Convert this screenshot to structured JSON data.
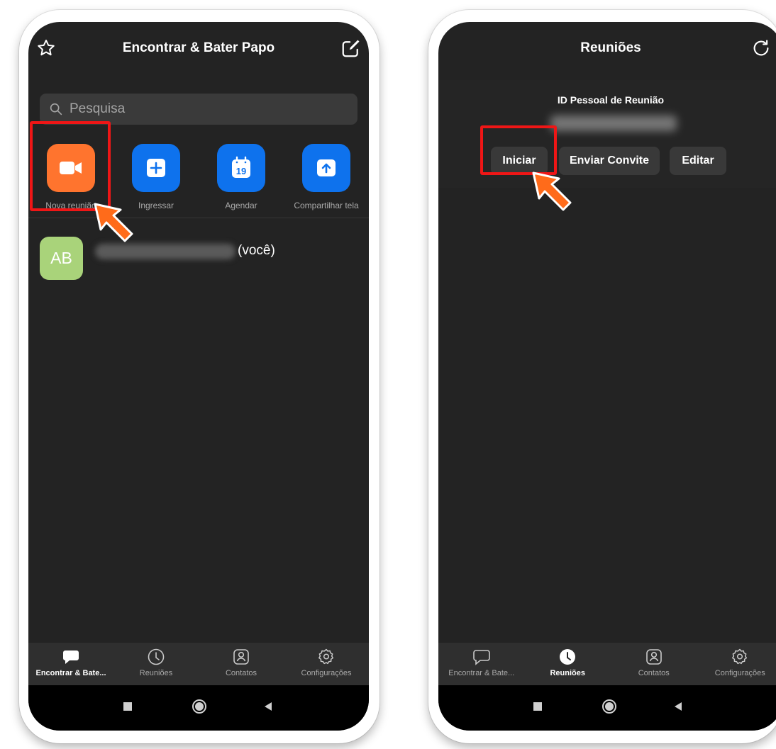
{
  "screen1": {
    "title": "Encontrar & Bater Papo",
    "search": {
      "placeholder": "Pesquisa"
    },
    "actions": [
      {
        "label": "Nova reunião",
        "icon": "video-camera-icon"
      },
      {
        "label": "Ingressar",
        "icon": "plus-icon"
      },
      {
        "label": "Agendar",
        "icon": "calendar-icon",
        "calendar_day": "19"
      },
      {
        "label": "Compartilhar tela",
        "icon": "share-screen-icon"
      }
    ],
    "contact": {
      "initials": "AB",
      "suffix": "(você)"
    },
    "tabs": [
      {
        "label": "Encontrar & Bate...",
        "icon": "chat-icon",
        "active": true
      },
      {
        "label": "Reuniões",
        "icon": "clock-icon",
        "active": false
      },
      {
        "label": "Contatos",
        "icon": "contacts-icon",
        "active": false
      },
      {
        "label": "Configurações",
        "icon": "gear-icon",
        "active": false
      }
    ]
  },
  "screen2": {
    "title": "Reuniões",
    "personal_meeting": {
      "label": "ID Pessoal de Reunião",
      "buttons": [
        "Iniciar",
        "Enviar Convite",
        "Editar"
      ]
    },
    "tabs": [
      {
        "label": "Encontrar & Bate...",
        "icon": "chat-icon",
        "active": false
      },
      {
        "label": "Reuniões",
        "icon": "clock-icon",
        "active": true
      },
      {
        "label": "Contatos",
        "icon": "contacts-icon",
        "active": false
      },
      {
        "label": "Configurações",
        "icon": "gear-icon",
        "active": false
      }
    ]
  },
  "colors": {
    "background": "#232323",
    "accent_orange": "#ff742e",
    "accent_blue": "#0e72ed",
    "highlight_red": "#ef1616",
    "pointer_arrow": "#ff6b1a"
  }
}
